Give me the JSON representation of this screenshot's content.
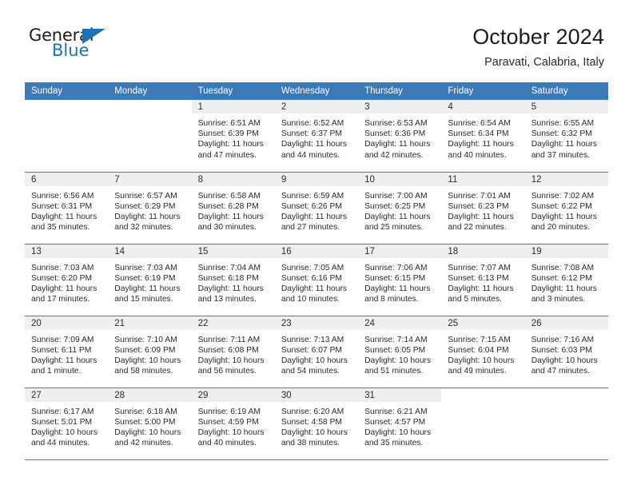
{
  "brand": {
    "name_top": "General",
    "name_bottom": "Blue",
    "accent_color": "#1b72b8"
  },
  "header": {
    "title": "October 2024",
    "subtitle": "Paravati, Calabria, Italy"
  },
  "theme": {
    "header_row_bg": "#3b79b8",
    "daynum_bg": "#efefef",
    "rule_color": "#3b79b8",
    "text_color": "#2b2b2b"
  },
  "weekdays": [
    "Sunday",
    "Monday",
    "Tuesday",
    "Wednesday",
    "Thursday",
    "Friday",
    "Saturday"
  ],
  "labels": {
    "sunrise_prefix": "Sunrise:",
    "sunset_prefix": "Sunset:",
    "daylight_prefix": "Daylight:"
  },
  "weeks": [
    [
      {
        "day": "",
        "blank": true
      },
      {
        "day": "",
        "blank": true
      },
      {
        "day": "1",
        "sunrise": "Sunrise: 6:51 AM",
        "sunset": "Sunset: 6:39 PM",
        "daylight_line1": "Daylight: 11 hours",
        "daylight_line2": "and 47 minutes."
      },
      {
        "day": "2",
        "sunrise": "Sunrise: 6:52 AM",
        "sunset": "Sunset: 6:37 PM",
        "daylight_line1": "Daylight: 11 hours",
        "daylight_line2": "and 44 minutes."
      },
      {
        "day": "3",
        "sunrise": "Sunrise: 6:53 AM",
        "sunset": "Sunset: 6:36 PM",
        "daylight_line1": "Daylight: 11 hours",
        "daylight_line2": "and 42 minutes."
      },
      {
        "day": "4",
        "sunrise": "Sunrise: 6:54 AM",
        "sunset": "Sunset: 6:34 PM",
        "daylight_line1": "Daylight: 11 hours",
        "daylight_line2": "and 40 minutes."
      },
      {
        "day": "5",
        "sunrise": "Sunrise: 6:55 AM",
        "sunset": "Sunset: 6:32 PM",
        "daylight_line1": "Daylight: 11 hours",
        "daylight_line2": "and 37 minutes."
      }
    ],
    [
      {
        "day": "6",
        "sunrise": "Sunrise: 6:56 AM",
        "sunset": "Sunset: 6:31 PM",
        "daylight_line1": "Daylight: 11 hours",
        "daylight_line2": "and 35 minutes."
      },
      {
        "day": "7",
        "sunrise": "Sunrise: 6:57 AM",
        "sunset": "Sunset: 6:29 PM",
        "daylight_line1": "Daylight: 11 hours",
        "daylight_line2": "and 32 minutes."
      },
      {
        "day": "8",
        "sunrise": "Sunrise: 6:58 AM",
        "sunset": "Sunset: 6:28 PM",
        "daylight_line1": "Daylight: 11 hours",
        "daylight_line2": "and 30 minutes."
      },
      {
        "day": "9",
        "sunrise": "Sunrise: 6:59 AM",
        "sunset": "Sunset: 6:26 PM",
        "daylight_line1": "Daylight: 11 hours",
        "daylight_line2": "and 27 minutes."
      },
      {
        "day": "10",
        "sunrise": "Sunrise: 7:00 AM",
        "sunset": "Sunset: 6:25 PM",
        "daylight_line1": "Daylight: 11 hours",
        "daylight_line2": "and 25 minutes."
      },
      {
        "day": "11",
        "sunrise": "Sunrise: 7:01 AM",
        "sunset": "Sunset: 6:23 PM",
        "daylight_line1": "Daylight: 11 hours",
        "daylight_line2": "and 22 minutes."
      },
      {
        "day": "12",
        "sunrise": "Sunrise: 7:02 AM",
        "sunset": "Sunset: 6:22 PM",
        "daylight_line1": "Daylight: 11 hours",
        "daylight_line2": "and 20 minutes."
      }
    ],
    [
      {
        "day": "13",
        "sunrise": "Sunrise: 7:03 AM",
        "sunset": "Sunset: 6:20 PM",
        "daylight_line1": "Daylight: 11 hours",
        "daylight_line2": "and 17 minutes."
      },
      {
        "day": "14",
        "sunrise": "Sunrise: 7:03 AM",
        "sunset": "Sunset: 6:19 PM",
        "daylight_line1": "Daylight: 11 hours",
        "daylight_line2": "and 15 minutes."
      },
      {
        "day": "15",
        "sunrise": "Sunrise: 7:04 AM",
        "sunset": "Sunset: 6:18 PM",
        "daylight_line1": "Daylight: 11 hours",
        "daylight_line2": "and 13 minutes."
      },
      {
        "day": "16",
        "sunrise": "Sunrise: 7:05 AM",
        "sunset": "Sunset: 6:16 PM",
        "daylight_line1": "Daylight: 11 hours",
        "daylight_line2": "and 10 minutes."
      },
      {
        "day": "17",
        "sunrise": "Sunrise: 7:06 AM",
        "sunset": "Sunset: 6:15 PM",
        "daylight_line1": "Daylight: 11 hours",
        "daylight_line2": "and 8 minutes."
      },
      {
        "day": "18",
        "sunrise": "Sunrise: 7:07 AM",
        "sunset": "Sunset: 6:13 PM",
        "daylight_line1": "Daylight: 11 hours",
        "daylight_line2": "and 5 minutes."
      },
      {
        "day": "19",
        "sunrise": "Sunrise: 7:08 AM",
        "sunset": "Sunset: 6:12 PM",
        "daylight_line1": "Daylight: 11 hours",
        "daylight_line2": "and 3 minutes."
      }
    ],
    [
      {
        "day": "20",
        "sunrise": "Sunrise: 7:09 AM",
        "sunset": "Sunset: 6:11 PM",
        "daylight_line1": "Daylight: 11 hours",
        "daylight_line2": "and 1 minute."
      },
      {
        "day": "21",
        "sunrise": "Sunrise: 7:10 AM",
        "sunset": "Sunset: 6:09 PM",
        "daylight_line1": "Daylight: 10 hours",
        "daylight_line2": "and 58 minutes."
      },
      {
        "day": "22",
        "sunrise": "Sunrise: 7:11 AM",
        "sunset": "Sunset: 6:08 PM",
        "daylight_line1": "Daylight: 10 hours",
        "daylight_line2": "and 56 minutes."
      },
      {
        "day": "23",
        "sunrise": "Sunrise: 7:13 AM",
        "sunset": "Sunset: 6:07 PM",
        "daylight_line1": "Daylight: 10 hours",
        "daylight_line2": "and 54 minutes."
      },
      {
        "day": "24",
        "sunrise": "Sunrise: 7:14 AM",
        "sunset": "Sunset: 6:05 PM",
        "daylight_line1": "Daylight: 10 hours",
        "daylight_line2": "and 51 minutes."
      },
      {
        "day": "25",
        "sunrise": "Sunrise: 7:15 AM",
        "sunset": "Sunset: 6:04 PM",
        "daylight_line1": "Daylight: 10 hours",
        "daylight_line2": "and 49 minutes."
      },
      {
        "day": "26",
        "sunrise": "Sunrise: 7:16 AM",
        "sunset": "Sunset: 6:03 PM",
        "daylight_line1": "Daylight: 10 hours",
        "daylight_line2": "and 47 minutes."
      }
    ],
    [
      {
        "day": "27",
        "sunrise": "Sunrise: 6:17 AM",
        "sunset": "Sunset: 5:01 PM",
        "daylight_line1": "Daylight: 10 hours",
        "daylight_line2": "and 44 minutes."
      },
      {
        "day": "28",
        "sunrise": "Sunrise: 6:18 AM",
        "sunset": "Sunset: 5:00 PM",
        "daylight_line1": "Daylight: 10 hours",
        "daylight_line2": "and 42 minutes."
      },
      {
        "day": "29",
        "sunrise": "Sunrise: 6:19 AM",
        "sunset": "Sunset: 4:59 PM",
        "daylight_line1": "Daylight: 10 hours",
        "daylight_line2": "and 40 minutes."
      },
      {
        "day": "30",
        "sunrise": "Sunrise: 6:20 AM",
        "sunset": "Sunset: 4:58 PM",
        "daylight_line1": "Daylight: 10 hours",
        "daylight_line2": "and 38 minutes."
      },
      {
        "day": "31",
        "sunrise": "Sunrise: 6:21 AM",
        "sunset": "Sunset: 4:57 PM",
        "daylight_line1": "Daylight: 10 hours",
        "daylight_line2": "and 35 minutes."
      },
      {
        "day": "",
        "blank": true
      },
      {
        "day": "",
        "blank": true
      }
    ]
  ]
}
